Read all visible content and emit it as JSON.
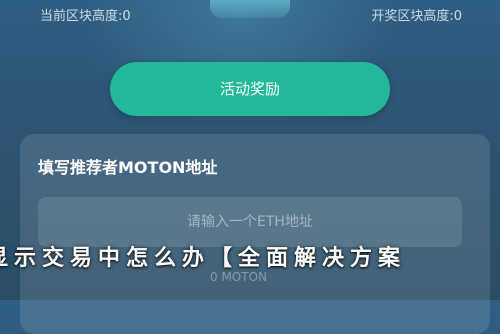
{
  "stats": {
    "left": {
      "label": "当前区块高度:",
      "value": "0"
    },
    "right": {
      "label": "开奖区块高度:",
      "value": "0"
    }
  },
  "cta": {
    "label": "活动奖励"
  },
  "referrer": {
    "title": "填写推荐者MOTON地址",
    "input_placeholder": "请输入一个ETH地址",
    "input_value": ""
  },
  "banner": {
    "text": "显示交易中怎么办【全面解决方案"
  },
  "faint_text": "0 MOTON"
}
